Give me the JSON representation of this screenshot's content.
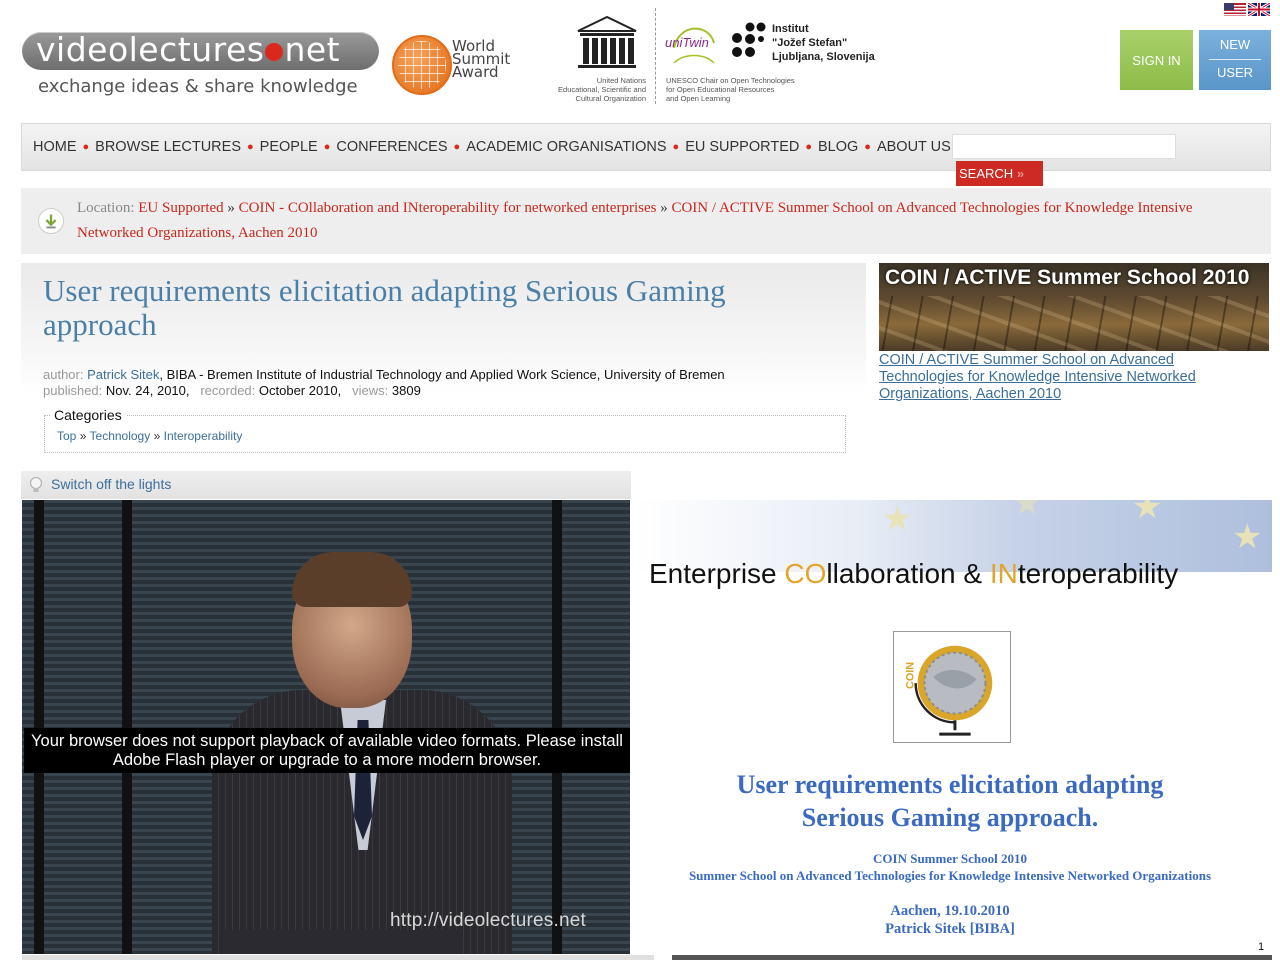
{
  "header": {
    "logo": {
      "part1": "videolectures",
      "part2": "net",
      "tagline": "exchange ideas & share knowledge"
    },
    "wsa": {
      "line1": "World",
      "line2": "Summit",
      "line3": "Award"
    },
    "unesco": {
      "word": "UNESCO",
      "caption": [
        "United Nations",
        "Educational, Scientific and",
        "Cultural Organization"
      ]
    },
    "unitwin": {
      "word": "uniTwin",
      "caption": [
        "UNESCO Chair on Open Technologies",
        "for Open Educational Resources",
        "and Open Learning"
      ]
    },
    "ijs": {
      "line1": "Institut",
      "line2": "\"Jožef Stefan\"",
      "line3": "Ljubljana, Slovenija"
    },
    "sign_in_label": "SIGN IN",
    "new_user_line1": "NEW",
    "new_user_line2": "USER"
  },
  "nav": {
    "items": [
      "HOME",
      "BROWSE LECTURES",
      "PEOPLE",
      "CONFERENCES",
      "ACADEMIC ORGANISATIONS",
      "EU SUPPORTED",
      "BLOG",
      "ABOUT US"
    ],
    "search_value": "",
    "search_label": "SEARCH"
  },
  "breadcrumb": {
    "label": "Location:",
    "items": [
      "EU Supported",
      "COIN - COllaboration and INteroperability for networked enterprises",
      "COIN / ACTIVE Summer School on Advanced Technologies for Knowledge Intensive Networked Organizations, Aachen 2010"
    ]
  },
  "lecture": {
    "title": "User requirements elicitation adapting Serious Gaming approach",
    "author_label": "author:",
    "author": "Patrick Sitek",
    "affiliation": ", BIBA - Bremen Institute of Industrial Technology and Applied Work Science, University of Bremen",
    "published_label": "published:",
    "published": "Nov. 24, 2010,",
    "recorded_label": "recorded:",
    "recorded": "October 2010,",
    "views_label": "views:",
    "views": "3809",
    "categories_label": "Categories",
    "categories": [
      "Top",
      "Technology",
      "Interoperability"
    ]
  },
  "event": {
    "image_title": "COIN / ACTIVE Summer School 2010",
    "link": "COIN / ACTIVE Summer School on Advanced Technologies for Knowledge Intensive Networked Organizations, Aachen 2010"
  },
  "player": {
    "lights_label": "Switch off the lights",
    "message": "Your browser does not support playback of available video formats. Please install Adobe Flash player or upgrade to a more modern browser.",
    "watermark": "http://videolectures.net"
  },
  "slide": {
    "heading_part1": "Enterprise ",
    "heading_hl1": "CO",
    "heading_part2": "llaboration & ",
    "heading_hl2": "IN",
    "heading_part3": "teroperability",
    "logo_word": "COIN",
    "title_line1": "User requirements elicitation adapting",
    "title_line2": "Serious Gaming approach.",
    "sub_line1": "COIN Summer School 2010",
    "sub_line2": "Summer School on Advanced Technologies for Knowledge Intensive Networked Organizations",
    "date_line1": "Aachen, 19.10.2010",
    "date_line2": "Patrick Sitek [BIBA]",
    "page_number": "1"
  },
  "colors": {
    "accent_red": "#cc2a22",
    "link_blue": "#3b6f9a",
    "title_blue": "#4a7fa8",
    "sign_in_green": "#9cc75a",
    "new_user_blue": "#6aa3d3"
  }
}
